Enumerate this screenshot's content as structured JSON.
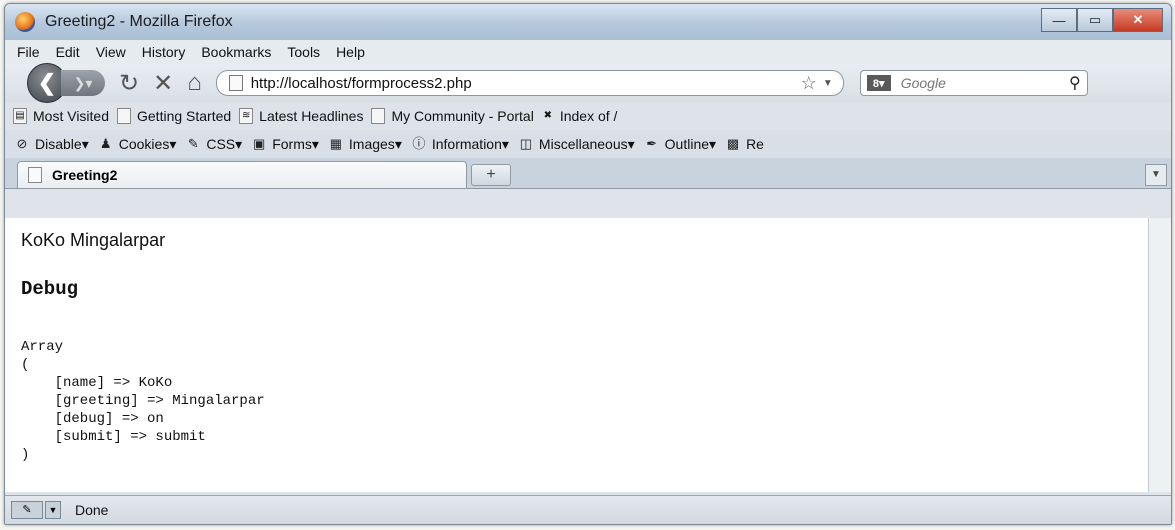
{
  "window": {
    "title": "Greeting2 - Mozilla Firefox",
    "controls": {
      "minimize": "—",
      "maximize": "▭",
      "close": "✕"
    }
  },
  "menu": [
    "File",
    "Edit",
    "View",
    "History",
    "Bookmarks",
    "Tools",
    "Help"
  ],
  "nav": {
    "url": "http://localhost/formprocess2.php",
    "search_placeholder": "Google",
    "search_engine_icon": "google-icon"
  },
  "bookmarks": [
    "Most Visited",
    "Getting Started",
    "Latest Headlines",
    "My Community - Portal",
    "Index of /"
  ],
  "devtoolbar": [
    "Disable",
    "Cookies",
    "CSS",
    "Forms",
    "Images",
    "Information",
    "Miscellaneous",
    "Outline",
    "Re"
  ],
  "tab": {
    "title": "Greeting2",
    "new_tab": "+"
  },
  "page": {
    "greeting": "KoKo Mingalarpar",
    "heading": "Debug",
    "dump": "Array\n(\n    [name] => KoKo\n    [greeting] => Mingalarpar\n    [debug] => on\n    [submit] => submit\n)"
  },
  "status": {
    "text": "Done"
  }
}
